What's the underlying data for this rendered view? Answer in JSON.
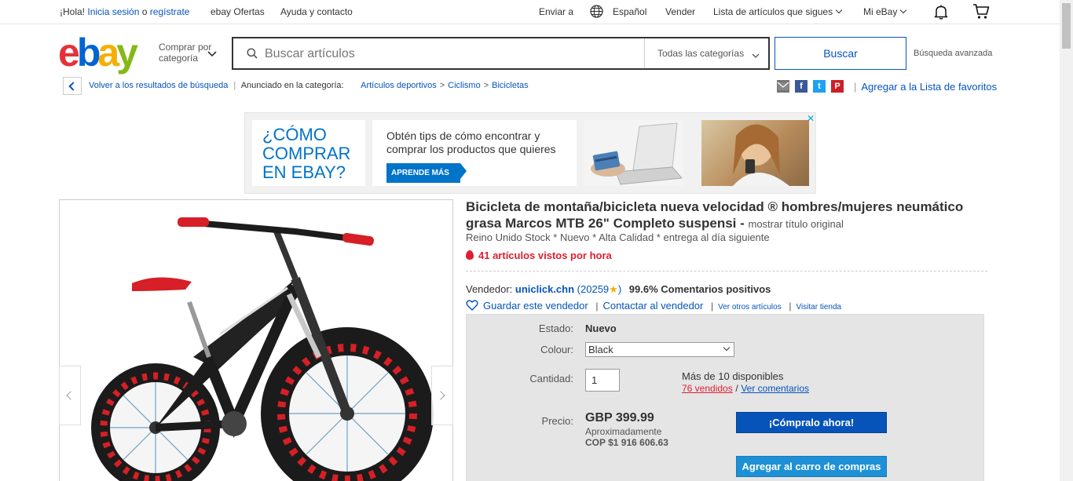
{
  "topbar": {
    "greeting": "¡Hola!",
    "signin": "Inicia sesión",
    "or": "o",
    "register": "regístrate",
    "deals": "ebay Ofertas",
    "help": "Ayuda y contacto",
    "ship_to": "Enviar a",
    "language": "Español",
    "sell": "Vender",
    "watchlist": "Lista de artículos que sigues",
    "my_ebay": "Mi eBay"
  },
  "header": {
    "shop_by_category": [
      "Comprar por",
      "categoría"
    ],
    "search_placeholder": "Buscar artículos",
    "category_select": "Todas las categorías",
    "search_button": "Buscar",
    "advanced": "Búsqueda avanzada"
  },
  "breadcrumb": {
    "back_label": "Volver a los resultados de búsqueda",
    "listed_in": "Anunciado en la categoría:",
    "items": [
      "Artículos deportivos",
      "Ciclismo",
      "Bicicletas"
    ],
    "add_to_watchlist": "Agregar a la Lista de favoritos"
  },
  "social": [
    {
      "name": "email",
      "glyph": "✉",
      "color": "#767676"
    },
    {
      "name": "facebook",
      "glyph": "f",
      "color": "#3b5998"
    },
    {
      "name": "twitter",
      "glyph": "t",
      "color": "#1da1f2"
    },
    {
      "name": "pinterest",
      "glyph": "P",
      "color": "#cb2027"
    }
  ],
  "banner": {
    "headline": [
      "¿CÓMO",
      "COMPRAR",
      "EN EBAY?"
    ],
    "body": [
      "Obtén tips de cómo encontrar y",
      "comprar los  productos que quieres"
    ],
    "cta": "APRENDE MÁS"
  },
  "item": {
    "title": "Bicicleta de montaña/bicicleta nueva velocidad ® hombres/mujeres neumático grasa Marcos MTB 26\" Completo suspensi -",
    "show_original": "mostrar título original",
    "subtitle": "Reino Unido Stock * Nuevo * Alta Calidad * entrega al día siguiente",
    "views_per_hour": "41 artículos vistos por hora"
  },
  "seller": {
    "label": "Vendedor:",
    "name": "uniclick.chn",
    "feedback_count": "20259",
    "positive": "99.6% Comentarios positivos",
    "save": "Guardar este vendedor",
    "contact": "Contactar al vendedor",
    "other_items": "Ver otros artículos",
    "visit_store": "Visitar tienda"
  },
  "purchase": {
    "condition_label": "Estado:",
    "condition": "Nuevo",
    "colour_label": "Colour:",
    "colour": "Black",
    "quantity_label": "Cantidad:",
    "quantity": "1",
    "available": "Más de 10 disponibles",
    "sold": "76 vendidos",
    "reviews": "Ver comentarios",
    "price_label": "Precio:",
    "price": "GBP 399.99",
    "approx_label": "Aproximadamente",
    "approx_value": "COP $1 916 606.63",
    "buy_now": "¡Cómpralo ahora!",
    "add_to_cart": "Agregar al carro de compras"
  }
}
